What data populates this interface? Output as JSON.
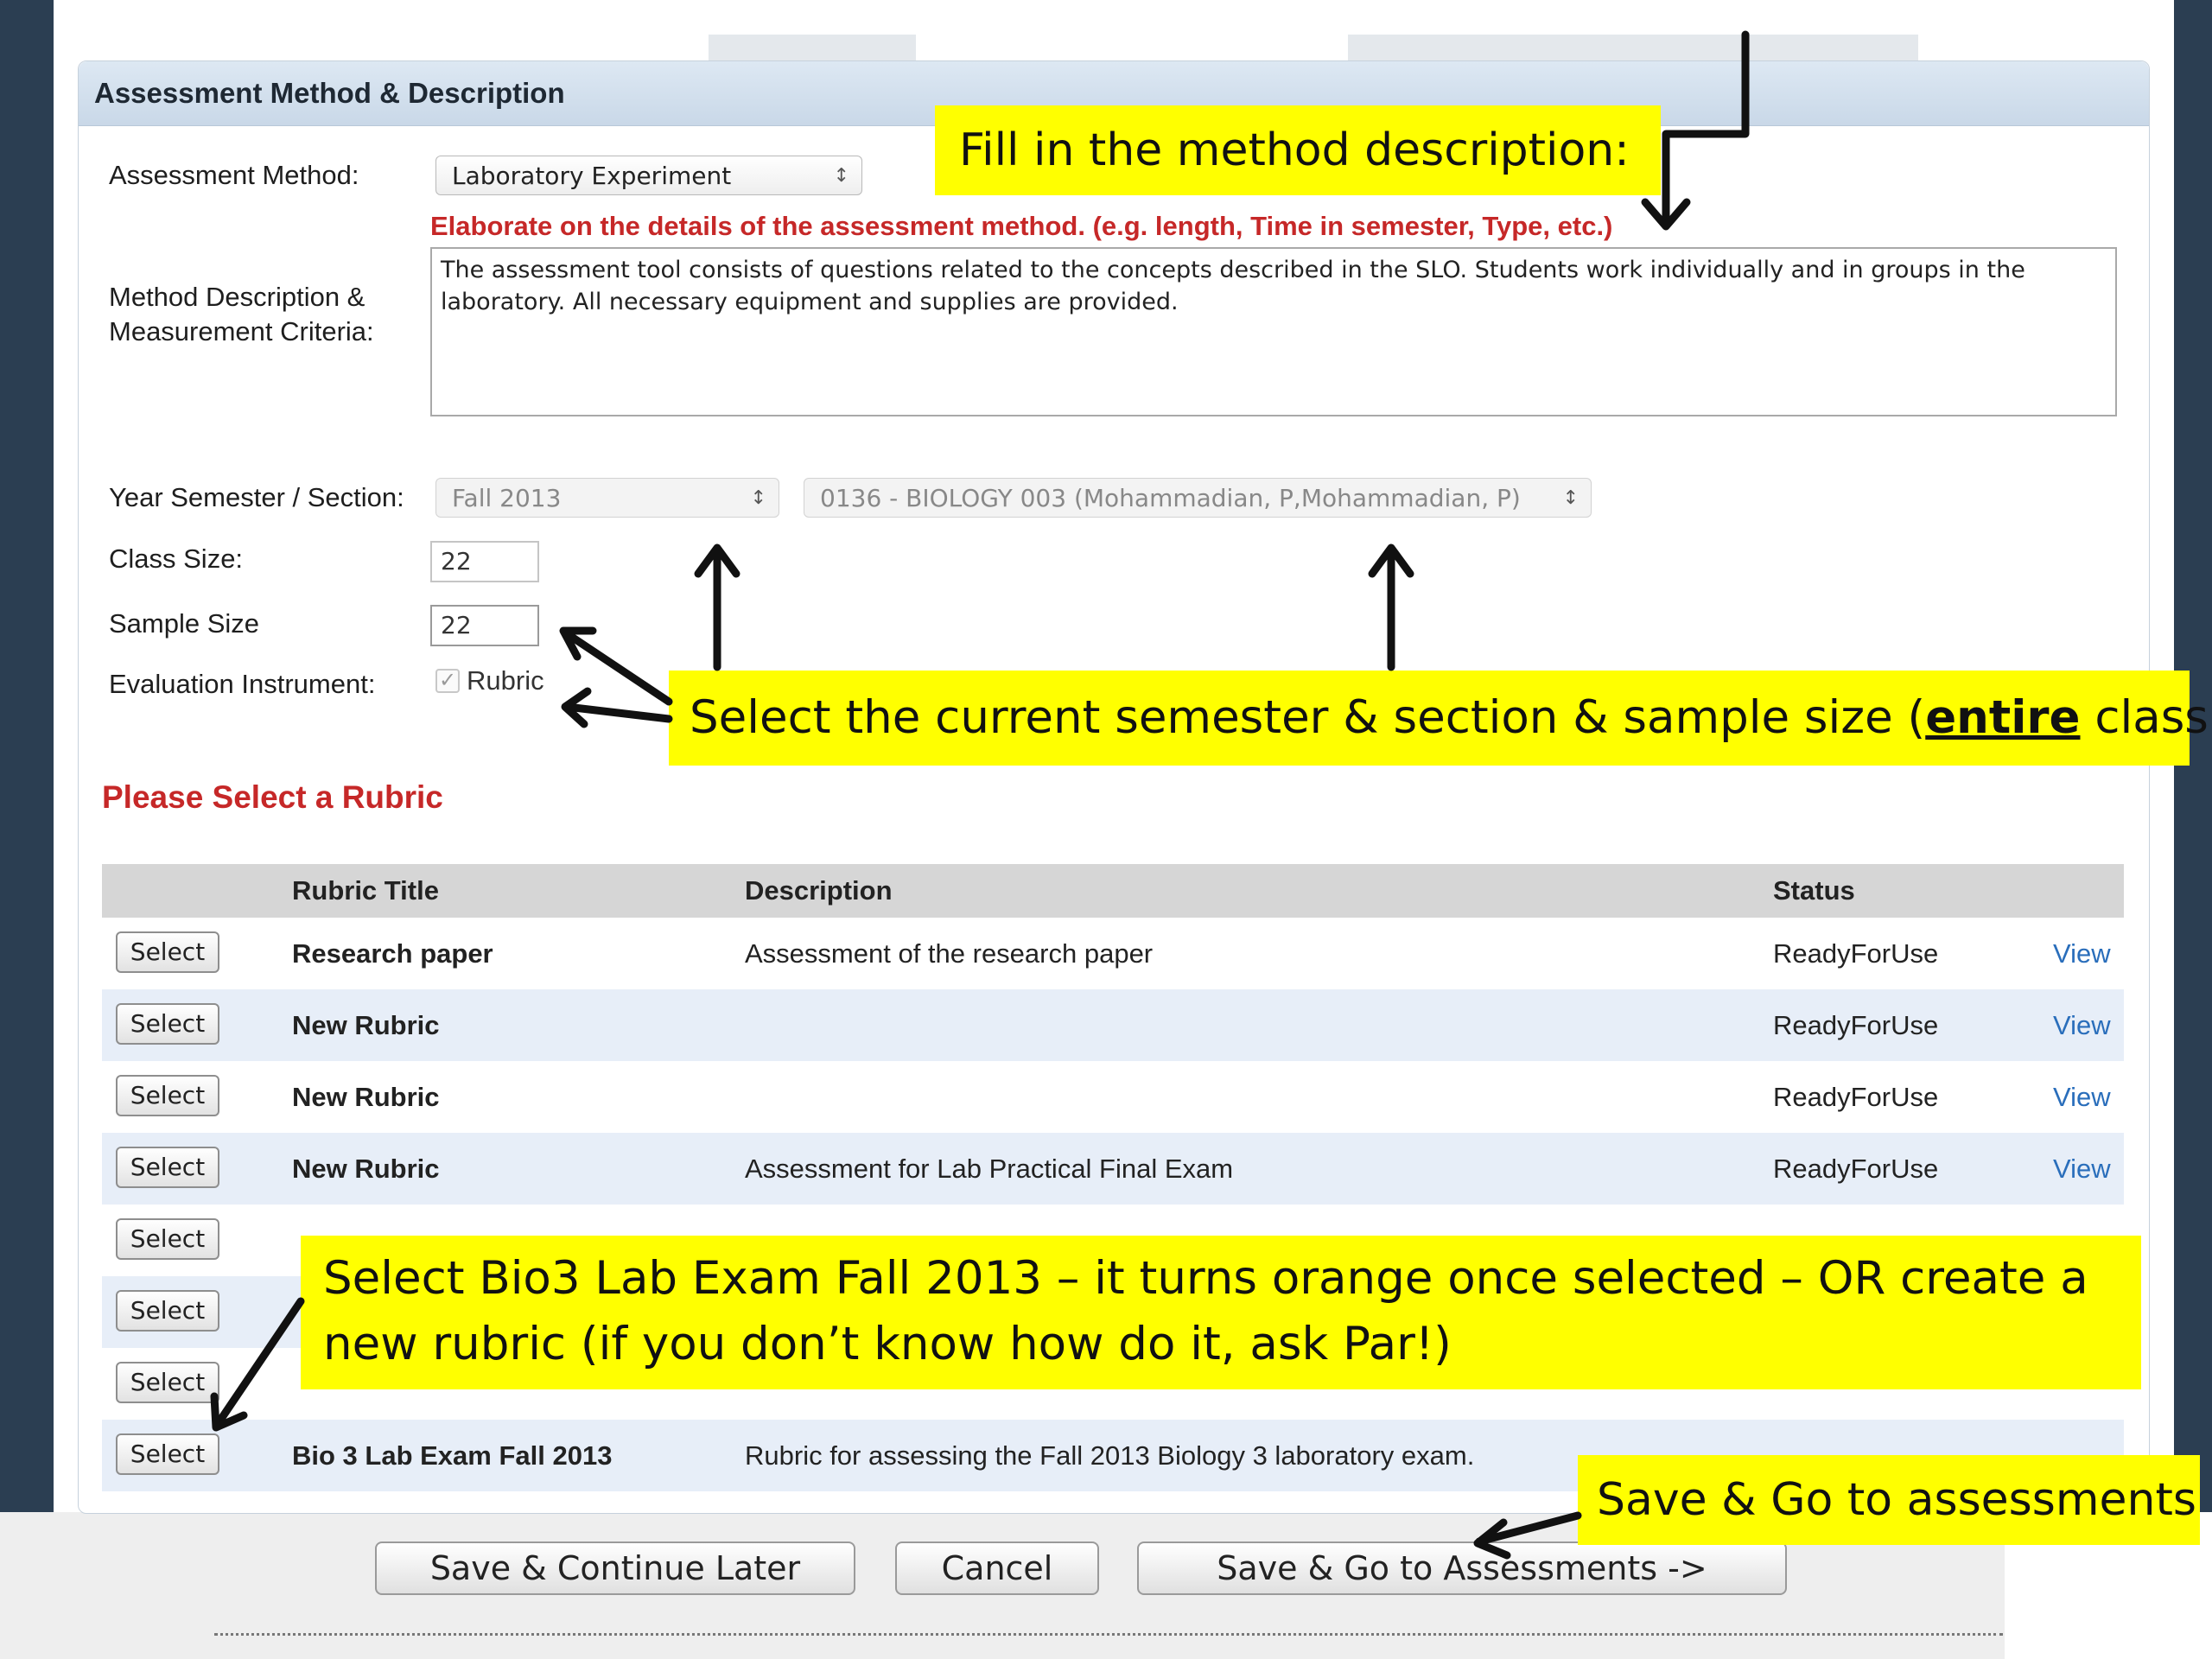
{
  "panel": {
    "title": "Assessment Method & Description"
  },
  "form": {
    "method_label": "Assessment Method:",
    "method_value": "Laboratory Experiment",
    "hint": "Elaborate on the details of the assessment method. (e.g. length, Time in semester, Type, etc.)",
    "description_label_line1": "Method Description &",
    "description_label_line2": "Measurement Criteria:",
    "description_line1": "The assessment tool consists of questions related to the concepts described in the SLO. Students work individually and in groups in the",
    "description_line2": "laboratory. All necessary equipment and supplies are provided.",
    "year_label": "Year Semester / Section:",
    "semester_value": "Fall 2013",
    "section_value": "0136 - BIOLOGY 003 (Mohammadian, P,Mohammadian, P)",
    "class_size_label": "Class Size:",
    "class_size_value": "22",
    "sample_size_label": "Sample Size",
    "sample_size_value": "22",
    "instrument_label": "Evaluation Instrument:",
    "instrument_option": "Rubric",
    "instrument_checked": true
  },
  "rubric_section": {
    "title": "Please Select a Rubric",
    "headers": {
      "title": "Rubric Title",
      "description": "Description",
      "status": "Status"
    },
    "select_label": "Select",
    "view_label": "View",
    "rows": [
      {
        "title": "Research paper",
        "description": "Assessment of the research paper",
        "status": "ReadyForUse"
      },
      {
        "title": "New Rubric",
        "description": "",
        "status": "ReadyForUse"
      },
      {
        "title": "New Rubric",
        "description": "",
        "status": "ReadyForUse"
      },
      {
        "title": "New Rubric",
        "description": "Assessment for Lab Practical Final Exam",
        "status": "ReadyForUse"
      },
      {
        "title": "",
        "description": "",
        "status": ""
      },
      {
        "title": "",
        "description": "",
        "status": ""
      },
      {
        "title": "",
        "description": "",
        "status": ""
      },
      {
        "title": "Bio 3 Lab Exam Fall 2013",
        "description": "Rubric for assessing the Fall 2013 Biology 3 laboratory exam.",
        "status": ""
      }
    ]
  },
  "actions": {
    "save_continue": "Save & Continue Later",
    "cancel": "Cancel",
    "save_go": "Save & Go to Assessments ->"
  },
  "callouts": {
    "method": "Fill in the method description:",
    "semester_before": "Select the current semester & section & sample size (",
    "semester_emph": "entire",
    "semester_after": " class)",
    "rubric_line1": "Select Bio3 Lab Exam Fall 2013 – it turns orange once selected – OR create a",
    "rubric_line2": "new rubric (if you don’t know how do it, ask Par!)",
    "save": "Save & Go to assessments"
  },
  "colors": {
    "callout": "#ffff00",
    "hint_red": "#c62828",
    "link_blue": "#2a6ebb",
    "row_alt": "#e7eef8",
    "frame": "#2b3e52"
  }
}
